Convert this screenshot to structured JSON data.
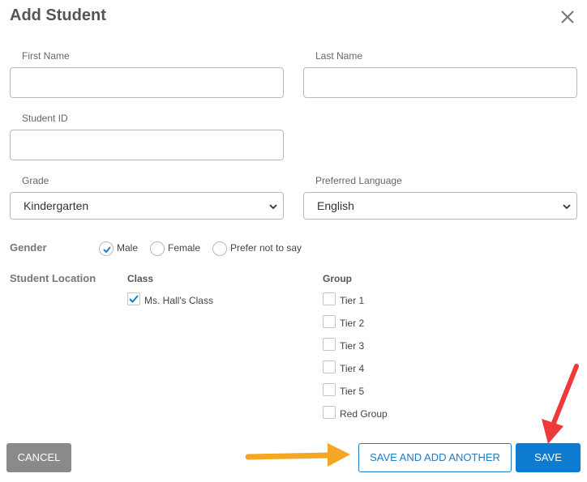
{
  "modal": {
    "title": "Add Student"
  },
  "fields": {
    "first_name": {
      "label": "First Name",
      "value": "",
      "placeholder": ""
    },
    "last_name": {
      "label": "Last Name",
      "value": "",
      "placeholder": ""
    },
    "student_id": {
      "label": "Student ID",
      "value": "",
      "placeholder": ""
    },
    "grade": {
      "label": "Grade",
      "value": "Kindergarten"
    },
    "language": {
      "label": "Preferred Language",
      "value": "English"
    }
  },
  "gender": {
    "label": "Gender",
    "options": [
      {
        "label": "Male",
        "selected": true
      },
      {
        "label": "Female",
        "selected": false
      },
      {
        "label": "Prefer not to say",
        "selected": false
      }
    ]
  },
  "location": {
    "label": "Student Location",
    "class_header": "Class",
    "group_header": "Group",
    "classes": [
      {
        "label": "Ms. Hall's Class",
        "checked": true
      }
    ],
    "groups": [
      {
        "label": "Tier 1",
        "checked": false
      },
      {
        "label": "Tier 2",
        "checked": false
      },
      {
        "label": "Tier 3",
        "checked": false
      },
      {
        "label": "Tier 4",
        "checked": false
      },
      {
        "label": "Tier 5",
        "checked": false
      },
      {
        "label": "Red Group",
        "checked": false
      }
    ]
  },
  "buttons": {
    "cancel": "CANCEL",
    "save_and_add": "SAVE AND ADD ANOTHER",
    "save": "SAVE"
  },
  "colors": {
    "primary": "#0d7bd0",
    "cancel_bg": "#8a8a8a",
    "orange_arrow": "#f5a623",
    "red_arrow": "#ee3a3a"
  }
}
